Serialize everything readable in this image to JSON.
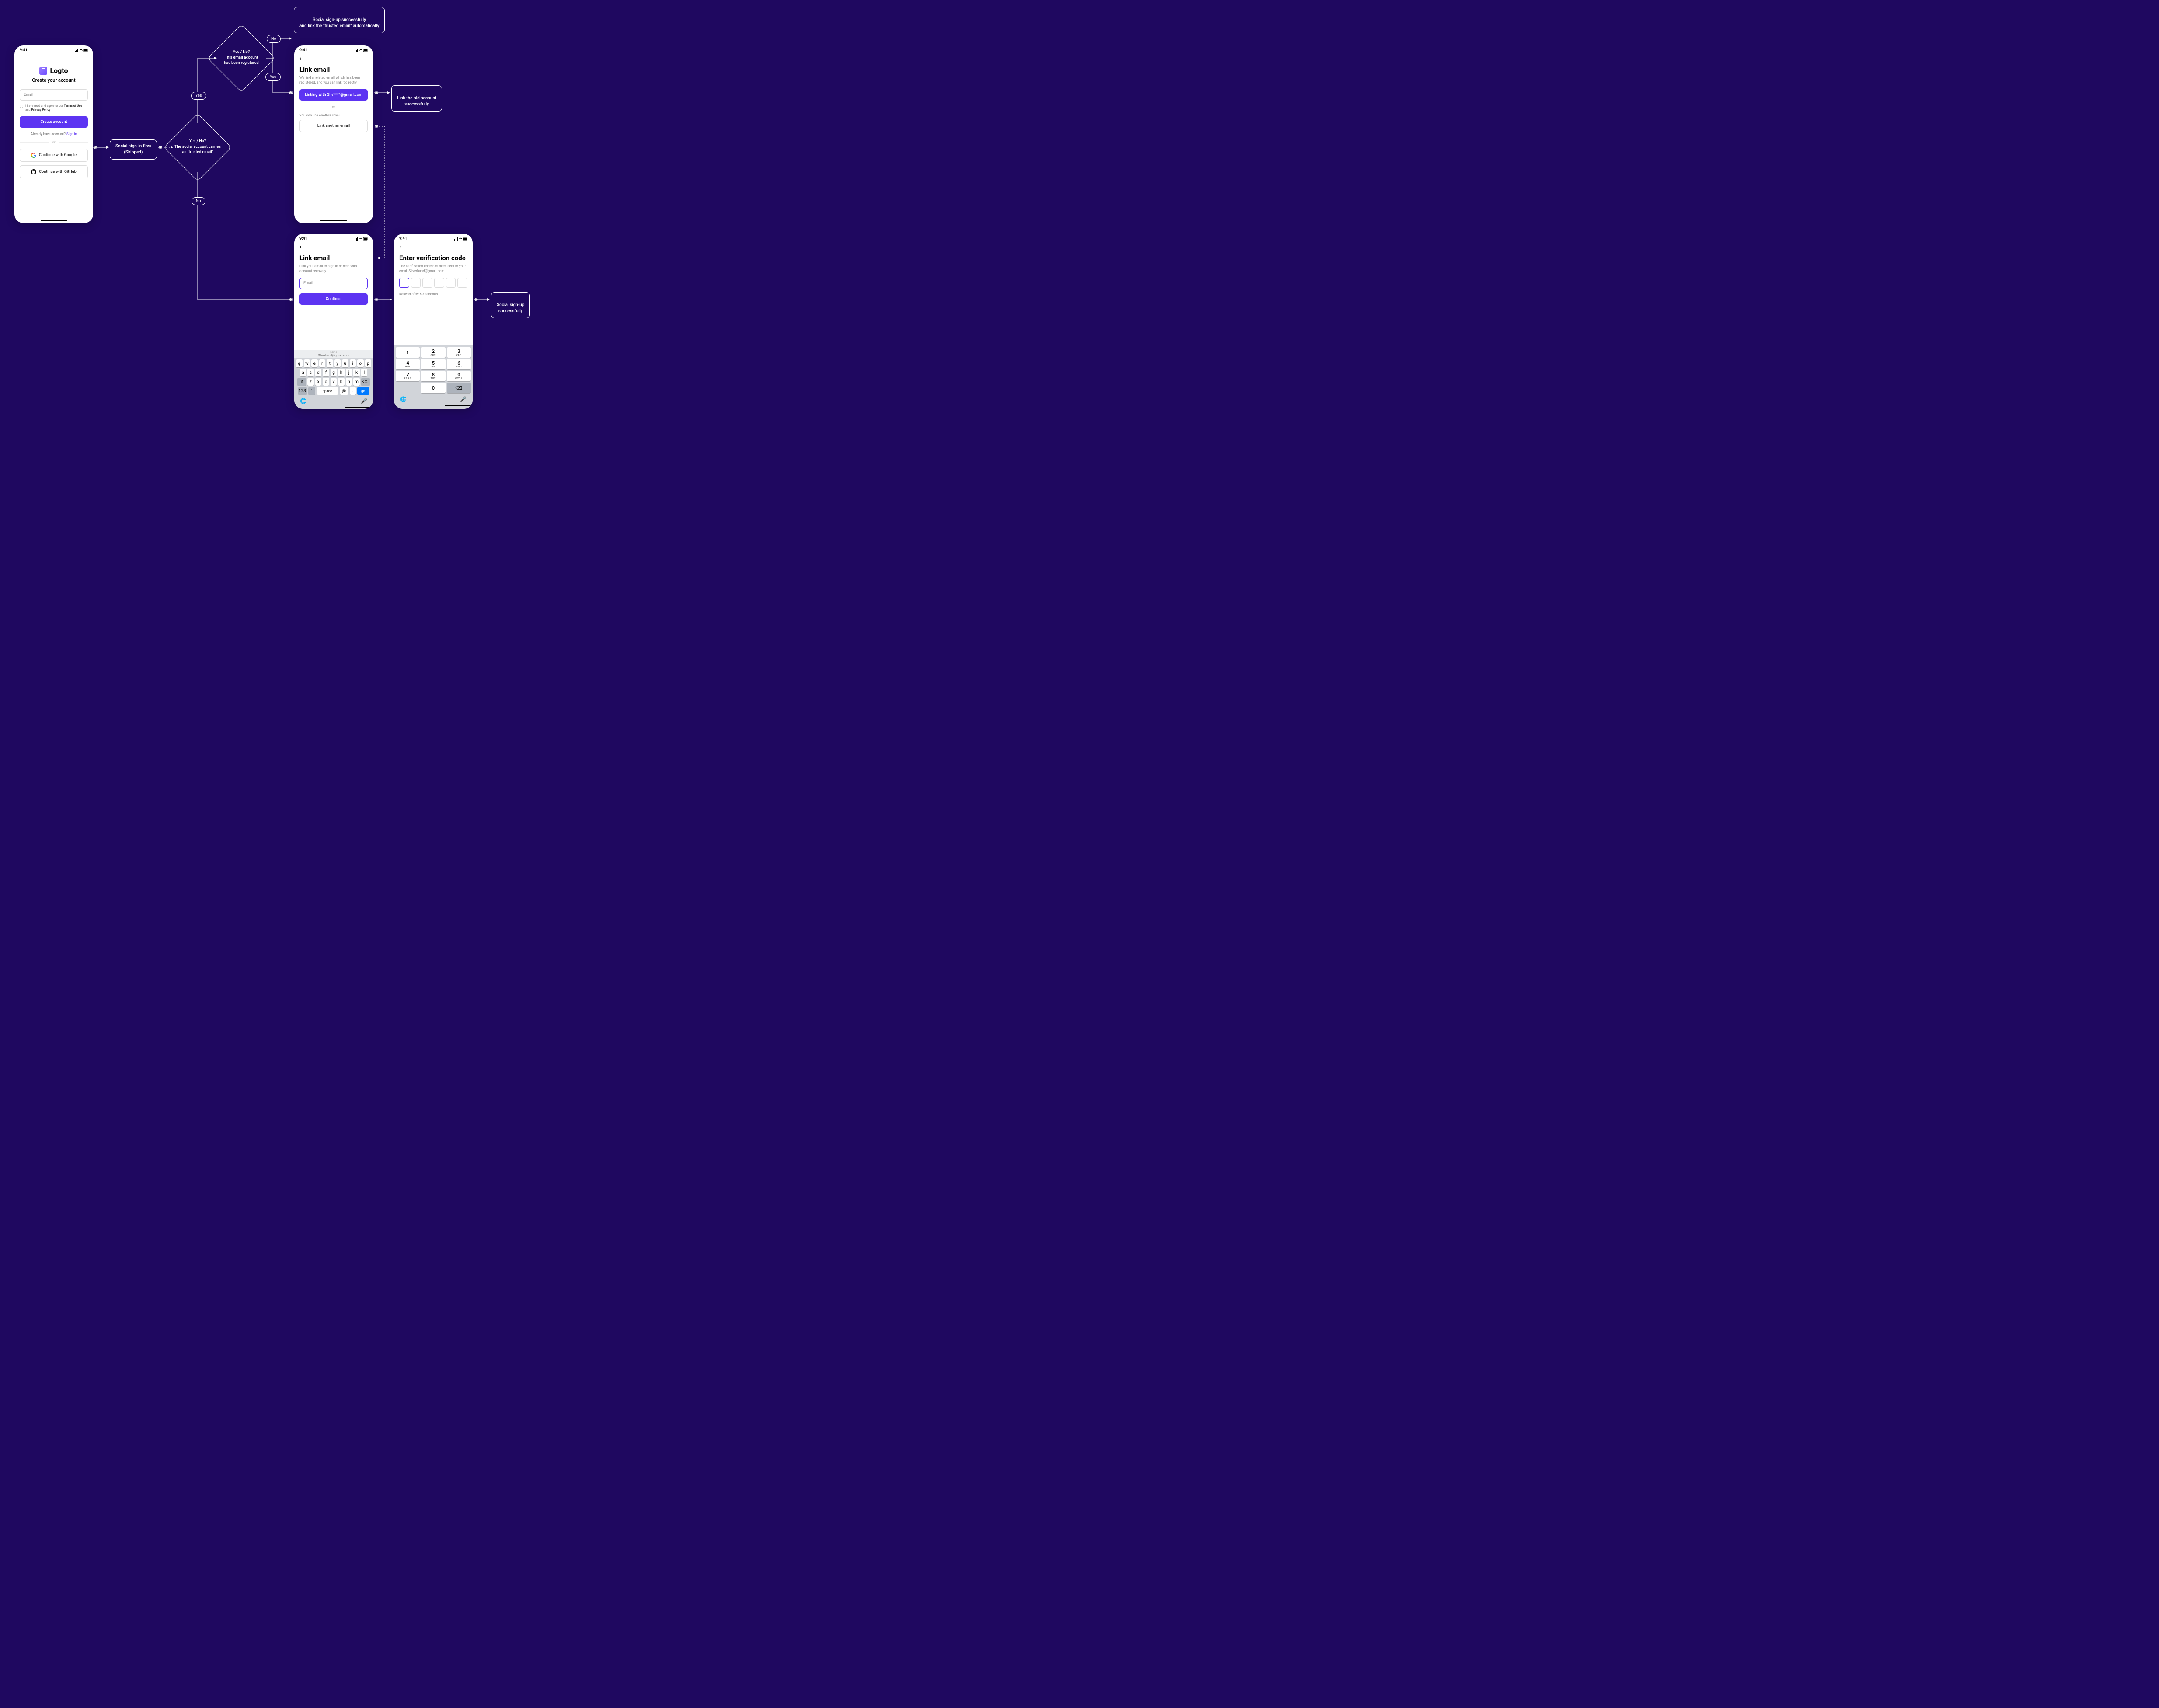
{
  "statusTime": "9:41",
  "phone1": {
    "brand": "Logto",
    "subtitle": "Create your account",
    "emailPlaceholder": "Email",
    "consentPrefix": "I have read and agree to our ",
    "terms": "Terms of Use",
    "and": " and ",
    "privacy": "Privacy Policy",
    "createBtn": "Create account",
    "alreadyPrefix": "Already have account? ",
    "signIn": "Sign in",
    "or": "or",
    "google": "Continue with Google",
    "github": "Continue with GitHub"
  },
  "phone2": {
    "title": "Link email",
    "desc": "We find a related email which has been registered, and you can link it directly.",
    "linkBtn": "Linking with Sliv****@gmail.com",
    "or": "or",
    "another": "You can link another email.",
    "anotherBtn": "Link another email"
  },
  "phone3": {
    "title": "Link email",
    "desc": "Link your email to sign in or help with account recovery.",
    "placeholder": "Email",
    "continue": "Continue",
    "suggLabel": "home",
    "sugg": "Silverhand@gmail.com",
    "rows": [
      [
        "q",
        "w",
        "e",
        "r",
        "t",
        "y",
        "u",
        "i",
        "o",
        "p"
      ],
      [
        "a",
        "s",
        "d",
        "f",
        "g",
        "h",
        "j",
        "k",
        "l"
      ],
      [
        "z",
        "x",
        "c",
        "v",
        "b",
        "n",
        "m"
      ]
    ],
    "space": "space",
    "num": "123",
    "go": "go",
    "at": "@",
    "dot": "."
  },
  "phone4": {
    "title": "Enter verification code",
    "desc": "The verification code has been sent to your email Silverhand@gmail.com",
    "resend": "Resend after 59 seconds",
    "keys": [
      [
        "1",
        ""
      ],
      [
        "2",
        "ABC"
      ],
      [
        "3",
        "DEF"
      ],
      [
        "4",
        "GHI"
      ],
      [
        "5",
        "JKL"
      ],
      [
        "6",
        "MNO"
      ],
      [
        "7",
        "PQRS"
      ],
      [
        "8",
        "TUV"
      ],
      [
        "9",
        "WXYZ"
      ]
    ]
  },
  "flow": {
    "skipped1": "Social sign-in flow",
    "skipped2": "(Skipped)",
    "d1a": "Yes / No?",
    "d1b": "The social account carries",
    "d1c": "an \"trusted email\"",
    "d2a": "Yes / No?",
    "d2b": "This email account",
    "d2c": "has been registered",
    "yes": "Yes",
    "no": "No",
    "t1": "Social sign-up successfully\nand link the \"trusted email\" automatically",
    "t2": "Link the old account\nsuccessfully",
    "t3": "Social sign-up\nsuccessfully"
  }
}
